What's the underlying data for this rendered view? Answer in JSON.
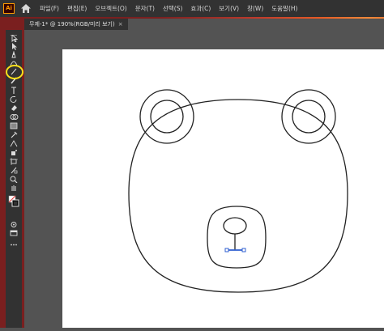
{
  "app": {
    "logo_text": "Ai"
  },
  "menu": {
    "items": [
      "파일(F)",
      "편집(E)",
      "오브젝트(O)",
      "문자(T)",
      "선택(S)",
      "효과(C)",
      "보기(V)",
      "창(W)",
      "도움말(H)"
    ]
  },
  "document_tab": {
    "title": "무제-1* @ 190%(RGB/미리 보기)",
    "close_glyph": "×"
  },
  "tools": [
    "selection-tool",
    "direct-selection-tool",
    "pen-tool",
    "curvature-tool",
    "line-segment-tool",
    "paintbrush-tool",
    "type-tool",
    "rotate-tool",
    "eraser-tool",
    "shape-builder-tool",
    "gradient-tool",
    "eyedropper-tool",
    "width-tool",
    "symbol-sprayer-tool",
    "artboard-tool",
    "slice-tool",
    "zoom-tool",
    "hand-tool",
    "fill-stroke-swatch",
    "draw-mode",
    "screen-mode",
    "more-tools"
  ],
  "active_tool": "line-segment-tool",
  "colors": {
    "highlight": "#ffe11a",
    "stroke": "#222222",
    "selection": "#2f5fd0"
  }
}
